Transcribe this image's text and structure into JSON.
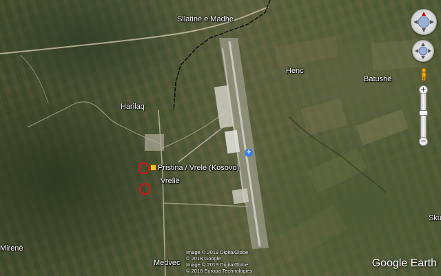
{
  "map": {
    "place_labels": {
      "slatine": "Sllatinë e Madhe",
      "henc": "Henc",
      "batushe": "Batushë",
      "harilaq": "Harilaq",
      "airport": "Pristina / Vrelë (Kosovo)",
      "vrelle": "Vrellë",
      "mirene": "Mirenë",
      "medvec": "Medvec",
      "sku": "Sku"
    },
    "imagery_credits": [
      "Image © 2019 DigitalGlobe",
      "© 2018 Google",
      "Image © 2019 DigitalGlobe",
      "© 2018 Europa Technologies"
    ],
    "brand": "Google Earth",
    "nav": {
      "zoom_in": "+",
      "zoom_out": "−"
    },
    "colors": {
      "marker": "#e01010",
      "airport_pin": "#f0c419",
      "runway": "#a9a9a0",
      "boundary": "#111111"
    },
    "icons": [
      "compass-icon",
      "move-icon",
      "pegman-icon",
      "airport-icon",
      "plane-icon"
    ]
  }
}
